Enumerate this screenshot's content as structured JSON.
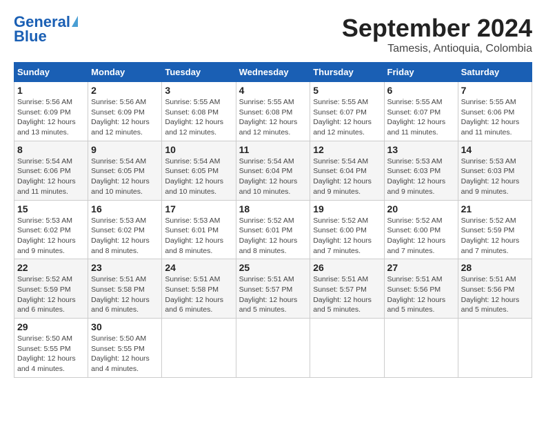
{
  "logo": {
    "line1": "General",
    "line2": "Blue"
  },
  "header": {
    "month": "September 2024",
    "location": "Tamesis, Antioquia, Colombia"
  },
  "weekdays": [
    "Sunday",
    "Monday",
    "Tuesday",
    "Wednesday",
    "Thursday",
    "Friday",
    "Saturday"
  ],
  "weeks": [
    [
      {
        "day": "1",
        "info": "Sunrise: 5:56 AM\nSunset: 6:09 PM\nDaylight: 12 hours\nand 13 minutes."
      },
      {
        "day": "2",
        "info": "Sunrise: 5:56 AM\nSunset: 6:09 PM\nDaylight: 12 hours\nand 12 minutes."
      },
      {
        "day": "3",
        "info": "Sunrise: 5:55 AM\nSunset: 6:08 PM\nDaylight: 12 hours\nand 12 minutes."
      },
      {
        "day": "4",
        "info": "Sunrise: 5:55 AM\nSunset: 6:08 PM\nDaylight: 12 hours\nand 12 minutes."
      },
      {
        "day": "5",
        "info": "Sunrise: 5:55 AM\nSunset: 6:07 PM\nDaylight: 12 hours\nand 12 minutes."
      },
      {
        "day": "6",
        "info": "Sunrise: 5:55 AM\nSunset: 6:07 PM\nDaylight: 12 hours\nand 11 minutes."
      },
      {
        "day": "7",
        "info": "Sunrise: 5:55 AM\nSunset: 6:06 PM\nDaylight: 12 hours\nand 11 minutes."
      }
    ],
    [
      {
        "day": "8",
        "info": "Sunrise: 5:54 AM\nSunset: 6:06 PM\nDaylight: 12 hours\nand 11 minutes."
      },
      {
        "day": "9",
        "info": "Sunrise: 5:54 AM\nSunset: 6:05 PM\nDaylight: 12 hours\nand 10 minutes."
      },
      {
        "day": "10",
        "info": "Sunrise: 5:54 AM\nSunset: 6:05 PM\nDaylight: 12 hours\nand 10 minutes."
      },
      {
        "day": "11",
        "info": "Sunrise: 5:54 AM\nSunset: 6:04 PM\nDaylight: 12 hours\nand 10 minutes."
      },
      {
        "day": "12",
        "info": "Sunrise: 5:54 AM\nSunset: 6:04 PM\nDaylight: 12 hours\nand 9 minutes."
      },
      {
        "day": "13",
        "info": "Sunrise: 5:53 AM\nSunset: 6:03 PM\nDaylight: 12 hours\nand 9 minutes."
      },
      {
        "day": "14",
        "info": "Sunrise: 5:53 AM\nSunset: 6:03 PM\nDaylight: 12 hours\nand 9 minutes."
      }
    ],
    [
      {
        "day": "15",
        "info": "Sunrise: 5:53 AM\nSunset: 6:02 PM\nDaylight: 12 hours\nand 9 minutes."
      },
      {
        "day": "16",
        "info": "Sunrise: 5:53 AM\nSunset: 6:02 PM\nDaylight: 12 hours\nand 8 minutes."
      },
      {
        "day": "17",
        "info": "Sunrise: 5:53 AM\nSunset: 6:01 PM\nDaylight: 12 hours\nand 8 minutes."
      },
      {
        "day": "18",
        "info": "Sunrise: 5:52 AM\nSunset: 6:01 PM\nDaylight: 12 hours\nand 8 minutes."
      },
      {
        "day": "19",
        "info": "Sunrise: 5:52 AM\nSunset: 6:00 PM\nDaylight: 12 hours\nand 7 minutes."
      },
      {
        "day": "20",
        "info": "Sunrise: 5:52 AM\nSunset: 6:00 PM\nDaylight: 12 hours\nand 7 minutes."
      },
      {
        "day": "21",
        "info": "Sunrise: 5:52 AM\nSunset: 5:59 PM\nDaylight: 12 hours\nand 7 minutes."
      }
    ],
    [
      {
        "day": "22",
        "info": "Sunrise: 5:52 AM\nSunset: 5:59 PM\nDaylight: 12 hours\nand 6 minutes."
      },
      {
        "day": "23",
        "info": "Sunrise: 5:51 AM\nSunset: 5:58 PM\nDaylight: 12 hours\nand 6 minutes."
      },
      {
        "day": "24",
        "info": "Sunrise: 5:51 AM\nSunset: 5:58 PM\nDaylight: 12 hours\nand 6 minutes."
      },
      {
        "day": "25",
        "info": "Sunrise: 5:51 AM\nSunset: 5:57 PM\nDaylight: 12 hours\nand 5 minutes."
      },
      {
        "day": "26",
        "info": "Sunrise: 5:51 AM\nSunset: 5:57 PM\nDaylight: 12 hours\nand 5 minutes."
      },
      {
        "day": "27",
        "info": "Sunrise: 5:51 AM\nSunset: 5:56 PM\nDaylight: 12 hours\nand 5 minutes."
      },
      {
        "day": "28",
        "info": "Sunrise: 5:51 AM\nSunset: 5:56 PM\nDaylight: 12 hours\nand 5 minutes."
      }
    ],
    [
      {
        "day": "29",
        "info": "Sunrise: 5:50 AM\nSunset: 5:55 PM\nDaylight: 12 hours\nand 4 minutes."
      },
      {
        "day": "30",
        "info": "Sunrise: 5:50 AM\nSunset: 5:55 PM\nDaylight: 12 hours\nand 4 minutes."
      },
      {
        "day": "",
        "info": ""
      },
      {
        "day": "",
        "info": ""
      },
      {
        "day": "",
        "info": ""
      },
      {
        "day": "",
        "info": ""
      },
      {
        "day": "",
        "info": ""
      }
    ]
  ]
}
